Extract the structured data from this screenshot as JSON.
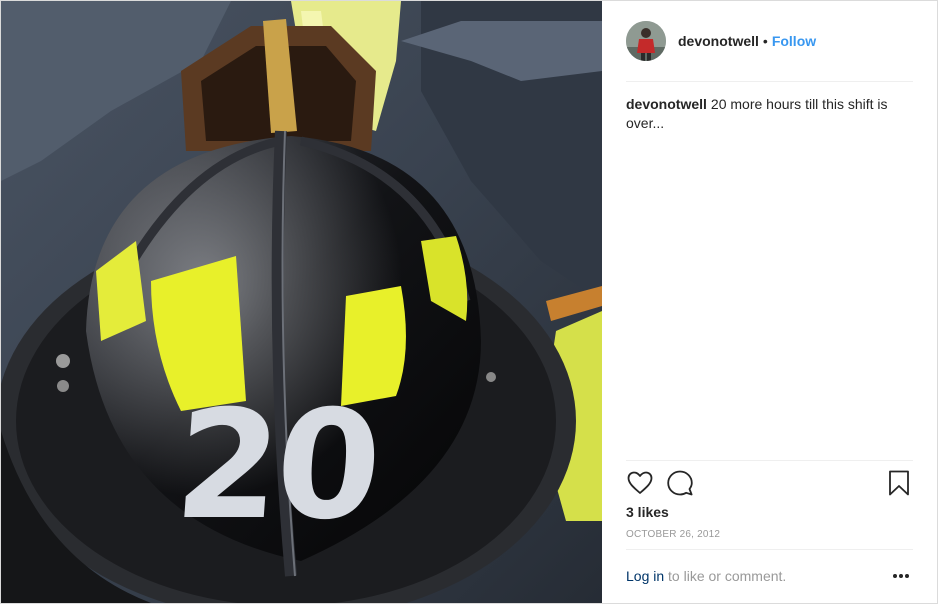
{
  "post": {
    "username": "devonotwell",
    "separator": "•",
    "follow_label": "Follow",
    "caption_user": "devonotwell",
    "caption_text": "20 more hours till this shift is over...",
    "likes": "3 likes",
    "date": "OCTOBER 26, 2012",
    "login_link": "Log in",
    "login_suffix": " to like or comment.",
    "helmet_number": "20"
  },
  "icons": {
    "like": "heart-icon",
    "comment": "comment-bubble-icon",
    "save": "bookmark-icon",
    "more": "more-options-icon"
  },
  "colors": {
    "link_blue": "#3897f0",
    "login_blue": "#003569",
    "text": "#262626",
    "muted": "#999999",
    "helmet_yellow": "#e8f02a"
  }
}
